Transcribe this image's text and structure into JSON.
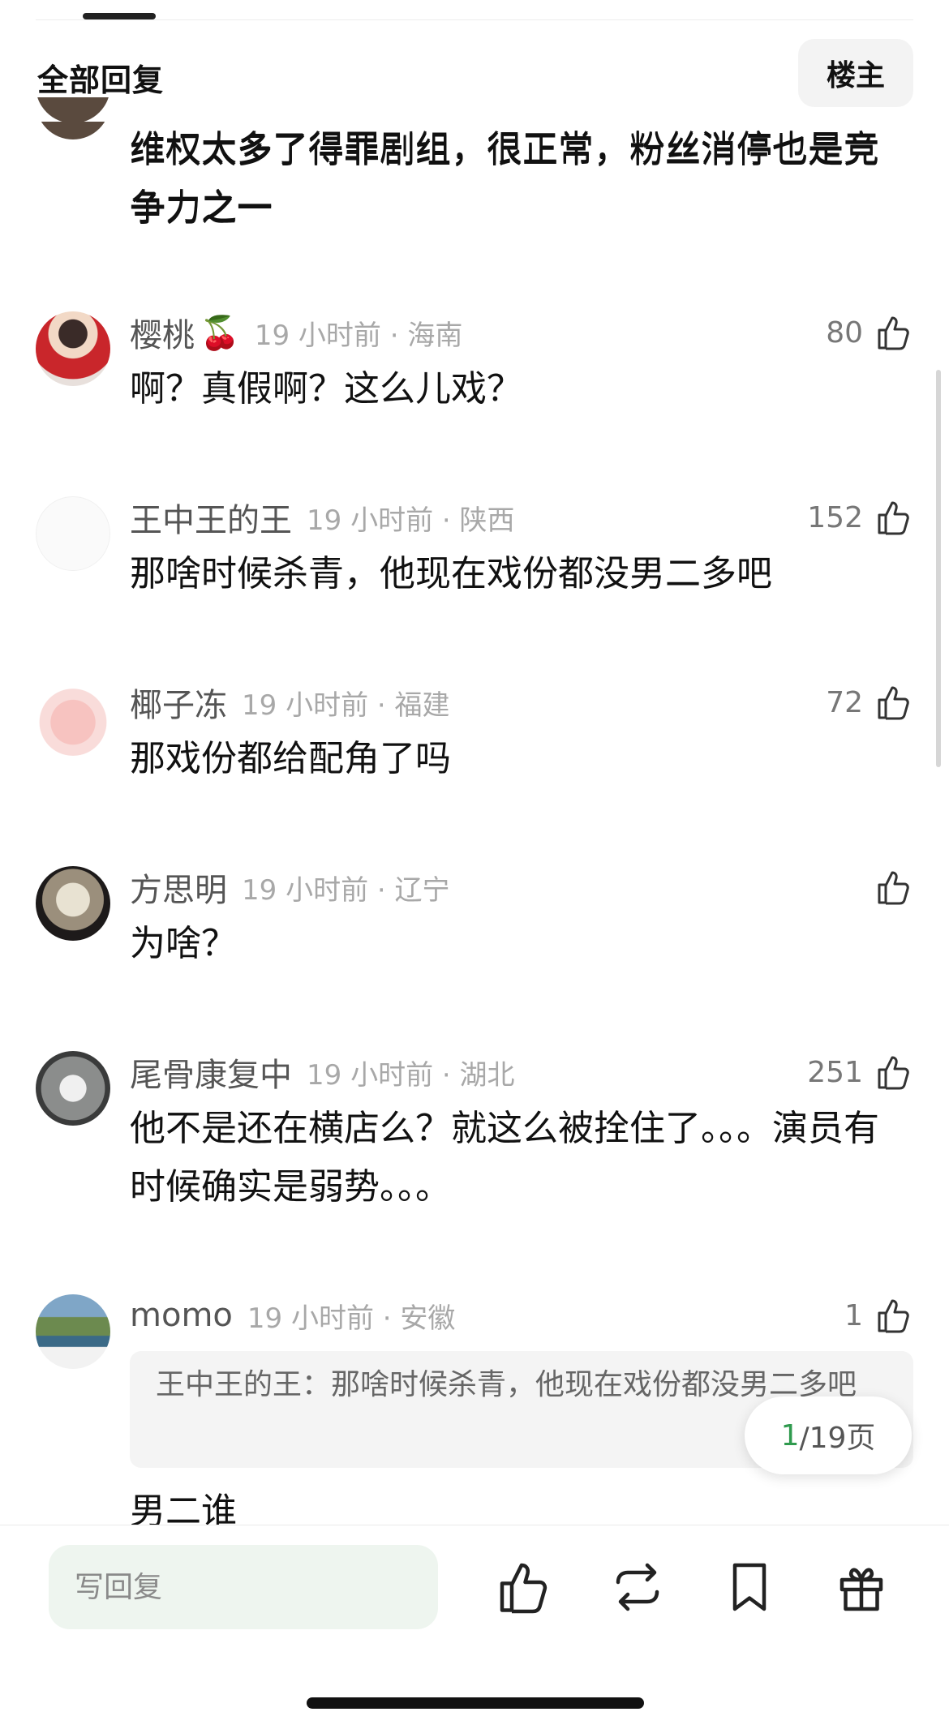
{
  "header": {
    "title": "全部回复",
    "op_button": "楼主"
  },
  "comments": [
    {
      "content": "维权太多了得罪剧组，很正常，粉丝消停也是竞争力之一"
    },
    {
      "username": "樱桃",
      "emoji": "🍒",
      "time": "19 小时前",
      "location": "海南",
      "likes": "80",
      "content": "啊？真假啊？这么儿戏？"
    },
    {
      "username": "王中王的王",
      "time": "19 小时前",
      "location": "陕西",
      "likes": "152",
      "content": "那啥时候杀青，他现在戏份都没男二多吧"
    },
    {
      "username": "椰子冻",
      "time": "19 小时前",
      "location": "福建",
      "likes": "72",
      "content": "那戏份都给配角了吗"
    },
    {
      "username": "方思明",
      "time": "19 小时前",
      "location": "辽宁",
      "likes": "",
      "content": "为啥？"
    },
    {
      "username": "尾骨康复中",
      "time": "19 小时前",
      "location": "湖北",
      "likes": "251",
      "content": "他不是还在横店么？就这么被拴住了。。。演员有时候确实是弱势。。。"
    },
    {
      "username": "momo",
      "time": "19 小时前",
      "location": "安徽",
      "likes": "1",
      "quote": "王中王的王：那啥时候杀青，他现在戏份都没男二多吧",
      "content": "男二谁"
    }
  ],
  "meta_separator": "·",
  "pagination": {
    "current": "1",
    "total": "/19页"
  },
  "bottom_bar": {
    "reply_placeholder": "写回复",
    "icons": [
      "thumbs-up-icon",
      "repost-icon",
      "bookmark-icon",
      "gift-icon"
    ]
  },
  "colors": {
    "page_indicator": "#2f9a4e",
    "reply_input_bg": "#eef5ef",
    "meta_text": "#a8a8a8"
  }
}
